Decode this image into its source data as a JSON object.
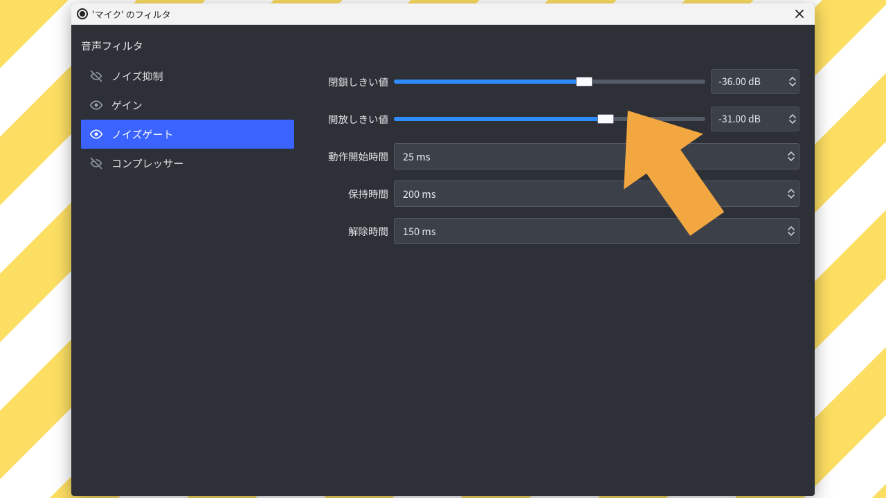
{
  "window": {
    "title": "'マイク' のフィルタ"
  },
  "section": {
    "title": "音声フィルタ"
  },
  "filters": {
    "items": [
      {
        "label": "ノイズ抑制",
        "visible": false
      },
      {
        "label": "ゲイン",
        "visible": true
      },
      {
        "label": "ノイズゲート",
        "visible": true,
        "selected": true
      },
      {
        "label": "コンプレッサー",
        "visible": false
      }
    ]
  },
  "settings": {
    "close_threshold": {
      "label": "閉鎖しきい値",
      "value_text": "-36.00 dB",
      "slider_percent": 61
    },
    "open_threshold": {
      "label": "開放しきい値",
      "value_text": "-31.00 dB",
      "slider_percent": 68
    },
    "attack_time": {
      "label": "動作開始時間",
      "value_text": "25 ms"
    },
    "hold_time": {
      "label": "保持時間",
      "value_text": "200 ms"
    },
    "release_time": {
      "label": "解除時間",
      "value_text": "150 ms"
    }
  },
  "colors": {
    "accent": "#3a63ff",
    "slider_fill": "#2f8cff",
    "panel_bg": "#2d3037",
    "input_bg": "#3c4049",
    "annotation_arrow": "#f2a740"
  }
}
